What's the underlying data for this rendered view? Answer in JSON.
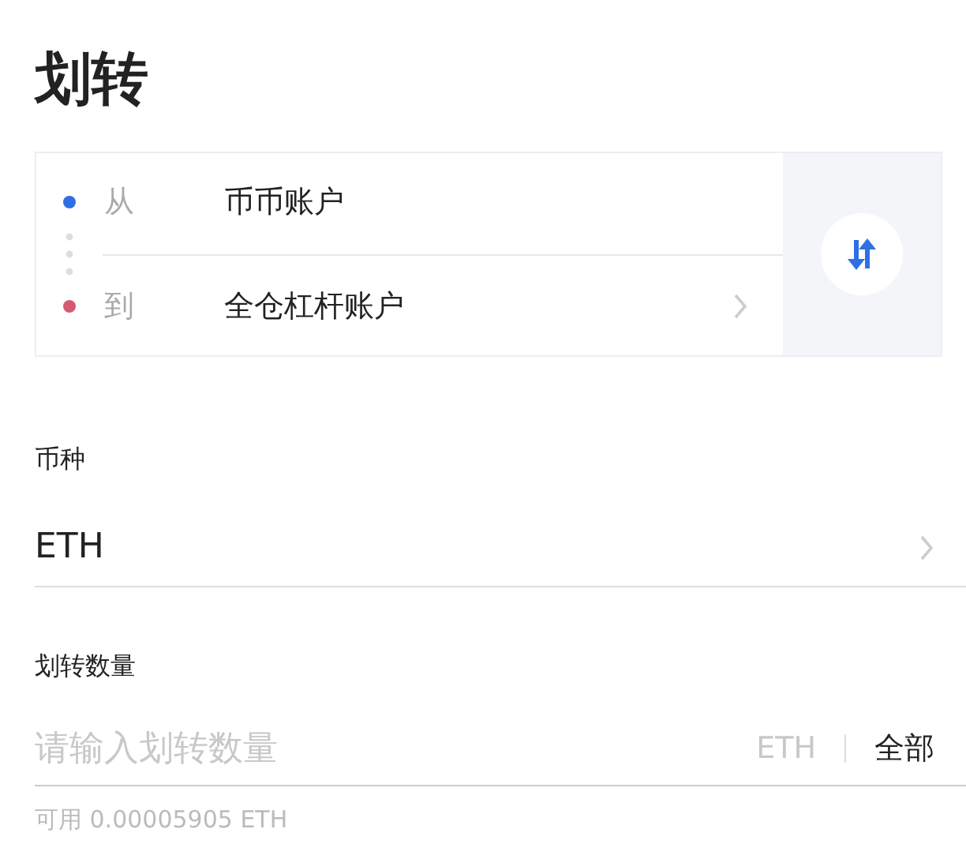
{
  "title": "划转",
  "transfer": {
    "rows": [
      {
        "label": "从",
        "account": "币币账户",
        "color": "#2f6fe4",
        "chevron": false
      },
      {
        "label": "到",
        "account": "全仓杠杆账户",
        "color": "#d45a72",
        "chevron": true
      }
    ]
  },
  "currency": {
    "label": "币种",
    "value": "ETH"
  },
  "amount": {
    "label": "划转数量",
    "placeholder": "请输入划转数量",
    "unit": "ETH",
    "all_button": "全部",
    "available": "可用 0.00005905 ETH"
  }
}
